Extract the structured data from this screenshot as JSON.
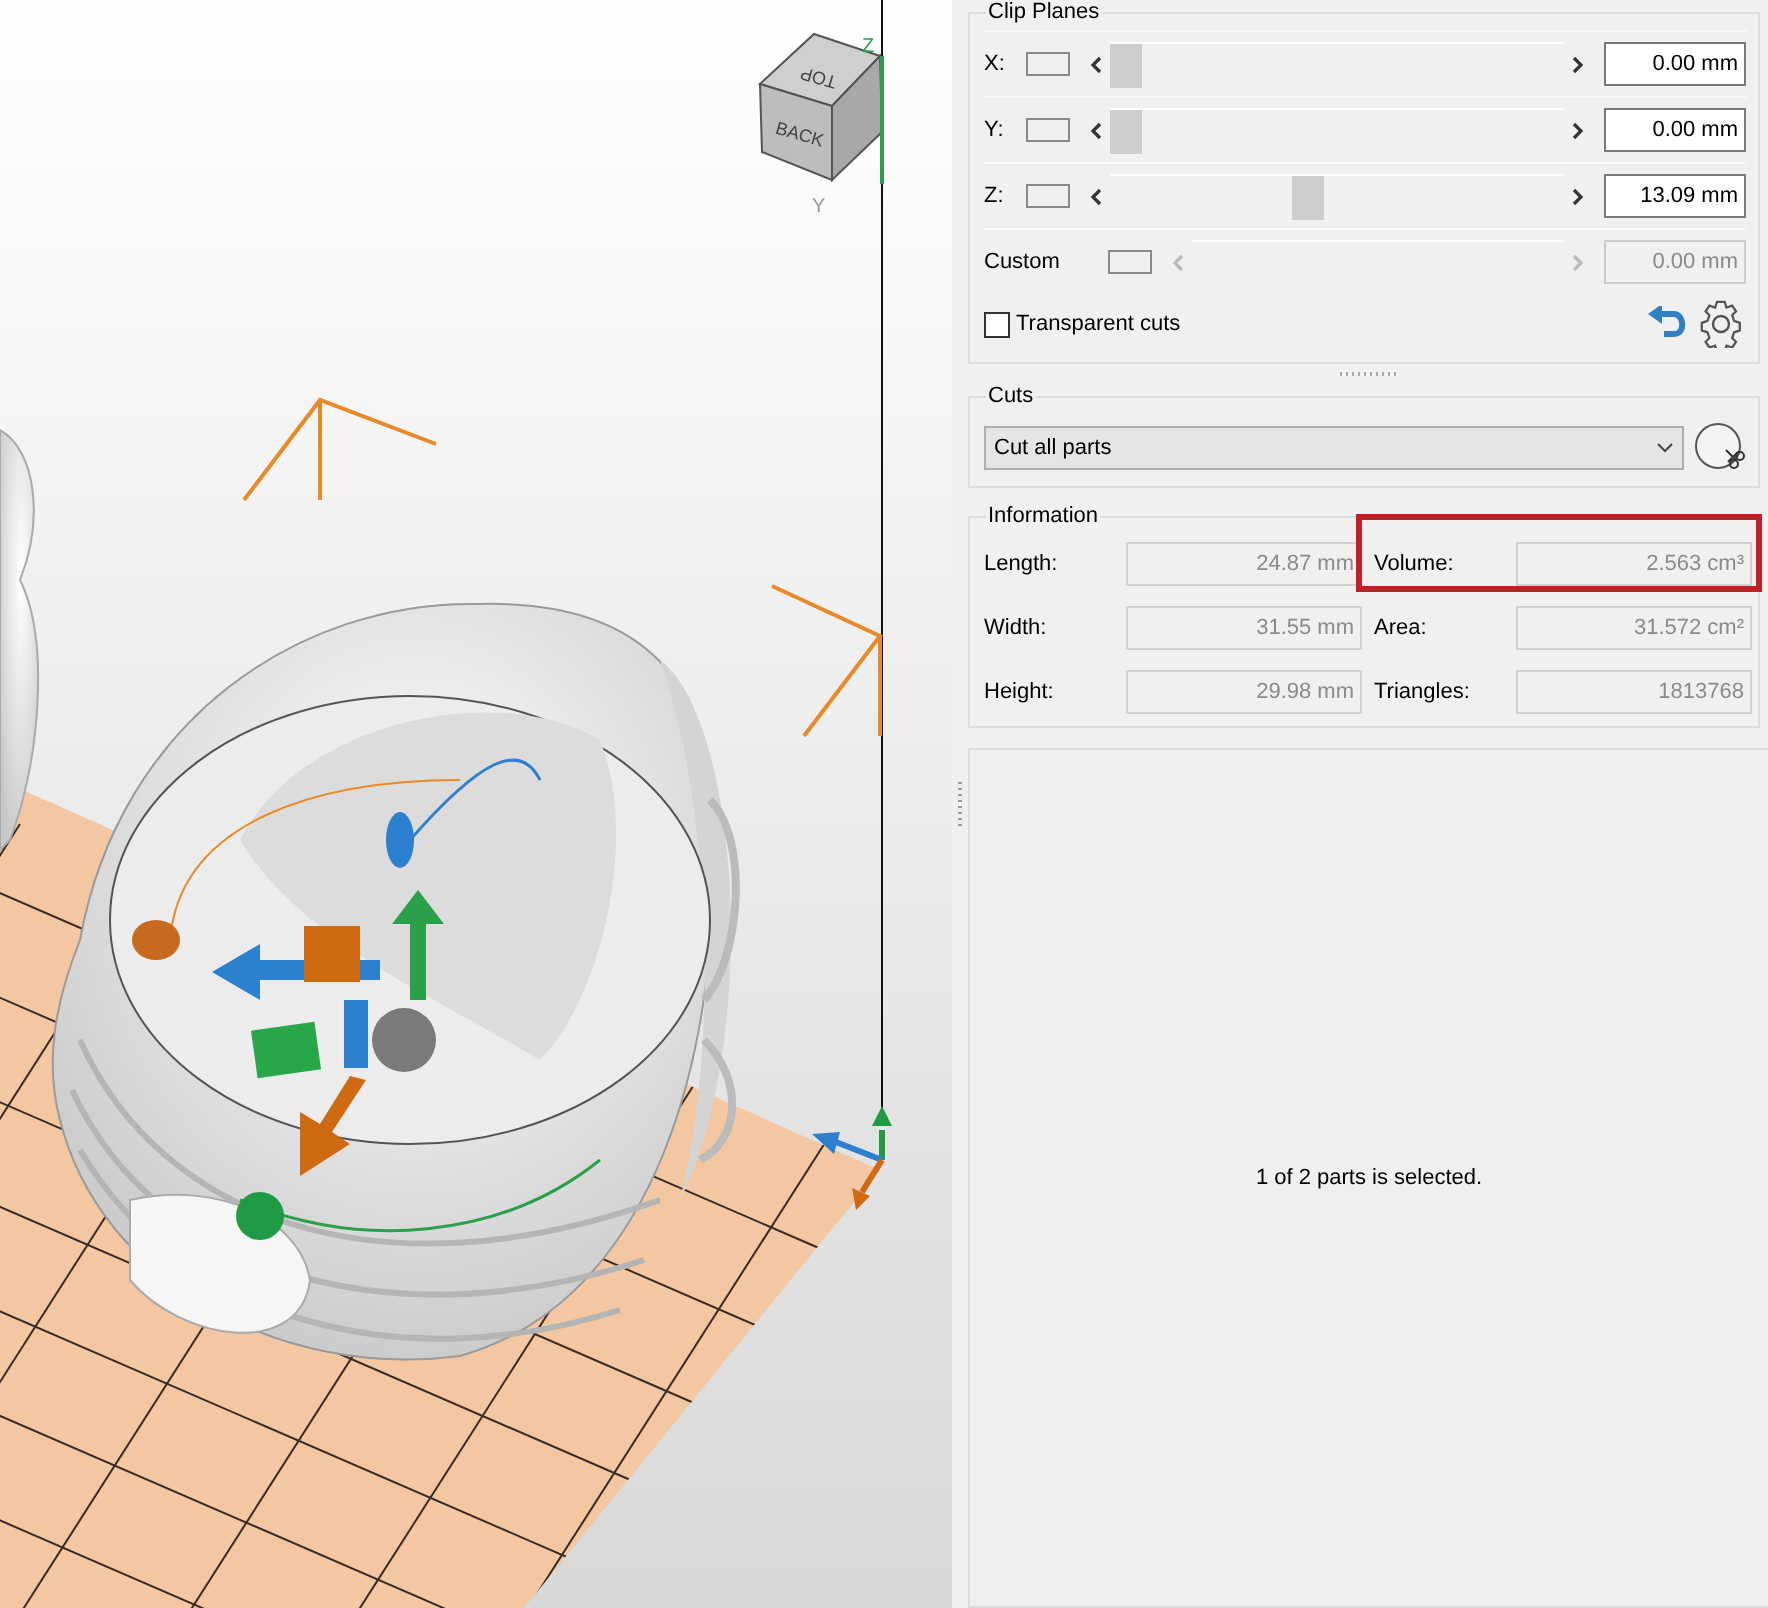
{
  "viewport": {
    "view_cube": {
      "faces": [
        "TOP",
        "BACK"
      ]
    },
    "axis_labels": [
      "Z",
      "Y"
    ]
  },
  "clip_planes": {
    "title": "Clip Planes",
    "rows": [
      {
        "kind": "axis",
        "label": "X:",
        "level": 0,
        "value": "0.00 mm",
        "disabled": false
      },
      {
        "kind": "axis",
        "label": "Y:",
        "level": 0,
        "value": "0.00 mm",
        "disabled": false
      },
      {
        "kind": "axis",
        "label": "Z:",
        "level": 0.43,
        "value": "13.09 mm",
        "disabled": false
      },
      {
        "kind": "custom",
        "label": "Custom",
        "value": "0.00 mm",
        "disabled": true
      }
    ],
    "transparent_cuts": {
      "label": "Transparent cuts",
      "checked": false
    }
  },
  "cuts": {
    "title": "Cuts",
    "dropdown": "Cut all parts"
  },
  "information": {
    "title": "Information",
    "fields": [
      {
        "label": "Length:",
        "value": "24.87 mm",
        "highlighted": false
      },
      {
        "label": "Volume:",
        "value": "2.563 cm³",
        "highlighted": true
      },
      {
        "label": "Width:",
        "value": "31.55 mm",
        "highlighted": false
      },
      {
        "label": "Area:",
        "value": "31.572 cm²",
        "highlighted": false
      },
      {
        "label": "Height:",
        "value": "29.98 mm",
        "highlighted": false
      },
      {
        "label": "Triangles:",
        "value": "1813768",
        "highlighted": false
      }
    ]
  },
  "status": "1 of 2 parts is selected."
}
